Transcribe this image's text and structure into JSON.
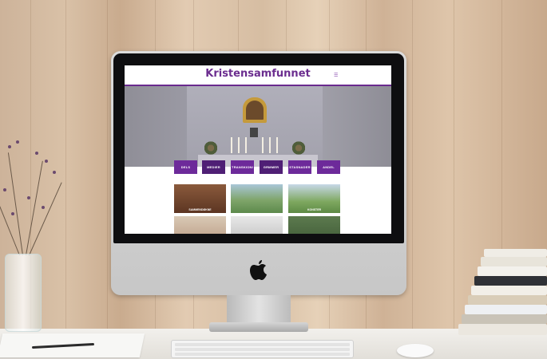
{
  "site": {
    "title": "Kristensamfunnet",
    "menu_icon": "hamburger-icon",
    "brand_color": "#6b2d8f"
  },
  "nav": {
    "items": [
      {
        "label": "DELS"
      },
      {
        "label": "MEDIER"
      },
      {
        "label": "TRANSKIONI"
      },
      {
        "label": "GRMMER"
      },
      {
        "label": "STASNADER"
      },
      {
        "label": "ANDEL"
      }
    ]
  },
  "tiles": [
    {
      "caption": "SAMMENDØKNE"
    },
    {
      "caption": ""
    },
    {
      "caption": "KONSTER"
    },
    {
      "caption": ""
    },
    {
      "caption": ""
    },
    {
      "caption": ""
    }
  ],
  "device": {
    "logo": "apple-logo-icon"
  }
}
